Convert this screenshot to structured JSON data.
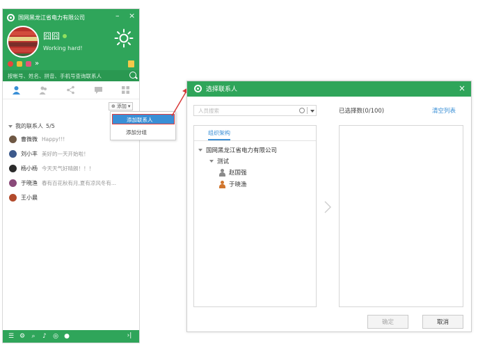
{
  "im": {
    "company": "国网黑龙江省电力有限公司",
    "minimize": "–",
    "close": "×",
    "nickname": "囧囧",
    "signature": "Working hard!",
    "search_placeholder": "按帐号、姓名、拼音、手机号查询联系人",
    "add_button": "添加",
    "menu": [
      "添加联系人",
      "添加分组"
    ],
    "group": {
      "name": "我的联系人",
      "count": "5/5"
    },
    "contacts": [
      {
        "name": "曹微微",
        "status": "Happy!!!",
        "color": "#6f5844"
      },
      {
        "name": "刘小丰",
        "status": "美好的一天开始啦！",
        "color": "#3d5a8c"
      },
      {
        "name": "杨小杨",
        "status": "今天天气好晴朗！！！",
        "color": "#2b2b2b"
      },
      {
        "name": "于晓渔",
        "status": "春有百花秋有月,夏有凉风冬有...",
        "color": "#8a4a7a"
      },
      {
        "name": "王小晨",
        "status": "",
        "color": "#b24a2c"
      }
    ],
    "footer_icons": [
      "menu-icon",
      "settings-icon",
      "search-icon",
      "speaker-icon",
      "location-icon",
      "mic-icon"
    ]
  },
  "dialog": {
    "title": "选择联系人",
    "close": "×",
    "search_placeholder": "人员搜索",
    "selected_count": "已选择数(0/100)",
    "clear": "清空列表",
    "org_tab": "组织架构",
    "tree": {
      "root": "国网黑龙江省电力有限公司",
      "dept": "测试",
      "members": [
        "赵国强",
        "于晓渔"
      ]
    },
    "ok": "确定",
    "cancel": "取消"
  },
  "colors": {
    "brand_green": "#2fa55a",
    "link_blue": "#3a8fd6",
    "highlight_red": "#e23b3b"
  }
}
